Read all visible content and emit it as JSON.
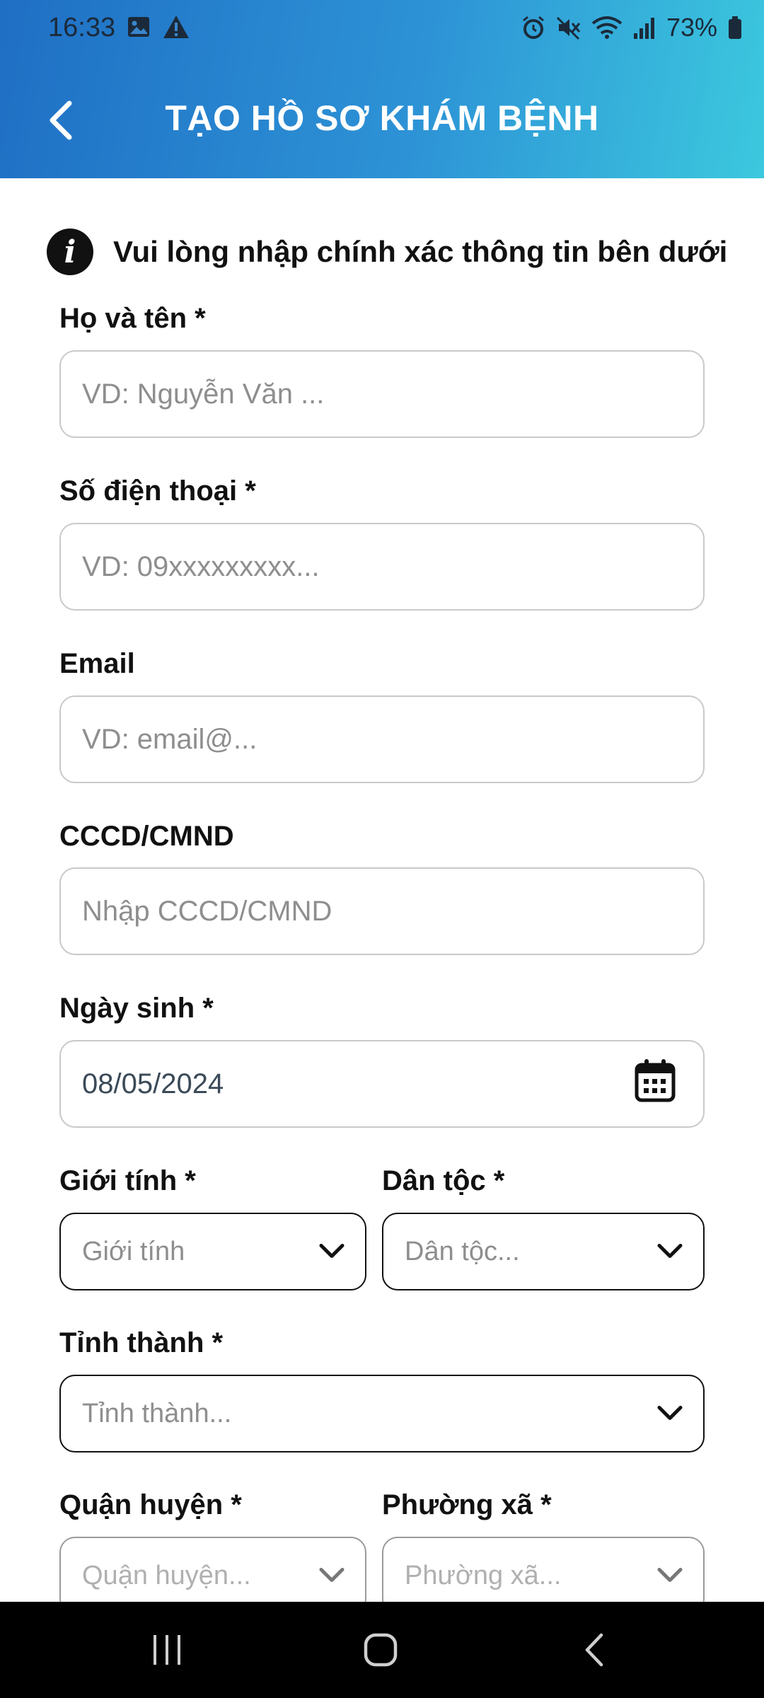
{
  "status_bar": {
    "time": "16:33",
    "battery": "73%",
    "left_icons": [
      "image-icon",
      "alert-triangle-icon"
    ],
    "right_icons": [
      "alarm-icon",
      "mute-icon",
      "wifi-icon",
      "signal-icon",
      "battery-icon"
    ]
  },
  "header": {
    "title": "TẠO HỒ SƠ KHÁM BỆNH",
    "background_start": "#1f6fc4",
    "background_end": "#3cc8de"
  },
  "info_message": "Vui lòng nhập chính xác thông tin bên dưới",
  "form": {
    "full_name": {
      "label": "Họ và tên *",
      "placeholder": "VD: Nguyễn Văn ..."
    },
    "phone": {
      "label": "Số điện thoại *",
      "placeholder": "VD: 09xxxxxxxxx..."
    },
    "email": {
      "label": "Email",
      "placeholder": "VD: email@..."
    },
    "id_card": {
      "label": "CCCD/CMND",
      "placeholder": "Nhập CCCD/CMND"
    },
    "birth_date": {
      "label": "Ngày sinh *",
      "value": "08/05/2024"
    },
    "gender": {
      "label": "Giới tính *",
      "placeholder": "Giới tính"
    },
    "ethnicity": {
      "label": "Dân tộc *",
      "placeholder": "Dân tộc..."
    },
    "province": {
      "label": "Tỉnh thành *",
      "placeholder": "Tỉnh thành..."
    },
    "district": {
      "label": "Quận huyện *",
      "placeholder": "Quận huyện..."
    },
    "ward": {
      "label": "Phường xã *",
      "placeholder": "Phường xã..."
    }
  },
  "nav_bar": {
    "buttons": [
      "recents-icon",
      "home-icon",
      "back-icon"
    ]
  }
}
